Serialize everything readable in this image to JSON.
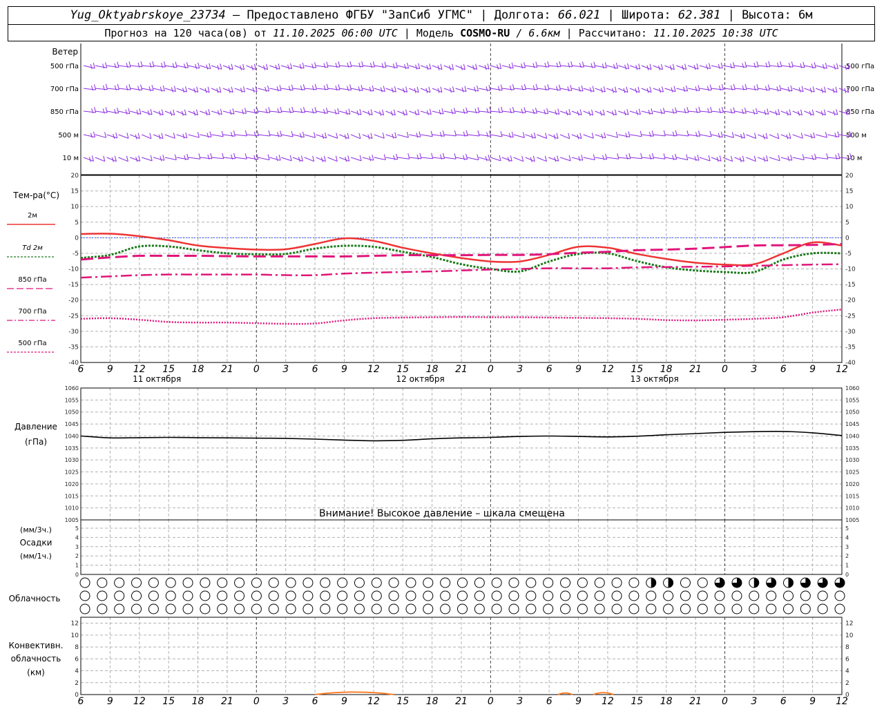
{
  "header": {
    "station": "Yug_Oktyabrskoye_23734",
    "provided_by": "– Предоставлено ФГБУ \"ЗапСиб УГМС\"",
    "lon_label": "Долгота:",
    "lon_value": "66.021",
    "lat_label": "Широта:",
    "lat_value": "62.381",
    "alt_label": "Высота:",
    "alt_value": "6м",
    "forecast_prefix": "Прогноз на 120 часа(ов) от",
    "forecast_start": "11.10.2025 06:00 UTC",
    "model_label": "Модель",
    "model_name": "COSMO-RU",
    "model_res": "/ 6.6км",
    "computed_label": "Рассчитано:",
    "computed_time": "11.10.2025 10:38 UTC"
  },
  "time_axis": {
    "hours": [
      "6",
      "9",
      "12",
      "15",
      "18",
      "21",
      "0",
      "3",
      "6",
      "9",
      "12",
      "15",
      "18",
      "21",
      "0",
      "3",
      "6",
      "9",
      "12",
      "15",
      "18",
      "21",
      "0",
      "3",
      "6",
      "9",
      "12"
    ],
    "day_labels": [
      {
        "text": "11 октября",
        "at_index": 3
      },
      {
        "text": "12 октября",
        "at_index": 12
      },
      {
        "text": "13 октября",
        "at_index": 20
      }
    ],
    "midnight_indices": [
      6,
      14,
      22
    ]
  },
  "wind": {
    "title": "Ветер",
    "levels": [
      "500 гПа",
      "700 гПа",
      "850 гПа",
      "500 м",
      "10 м"
    ],
    "color": "#8a2be2"
  },
  "temperature": {
    "title": "Тем-ра(°С)",
    "ticks": [
      20,
      15,
      10,
      5,
      0,
      -5,
      -10,
      -15,
      -20,
      -25,
      -30,
      -35,
      -40
    ],
    "legend": [
      {
        "label": "2м",
        "color": "#ee3333",
        "style": "solid"
      },
      {
        "label": "Td  2м",
        "color": "#1a7a1a",
        "style": "dotted"
      },
      {
        "label": "850 гПа",
        "color": "#e0147a",
        "style": "dash"
      },
      {
        "label": "700 гПа",
        "color": "#e0147a",
        "style": "dashdot"
      },
      {
        "label": "500 гПа",
        "color": "#e0147a",
        "style": "dot"
      }
    ]
  },
  "pressure": {
    "title_line1": "Давление",
    "title_line2": "(гПа)",
    "ticks": [
      1060,
      1055,
      1050,
      1045,
      1040,
      1035,
      1030,
      1025,
      1020,
      1015,
      1010,
      1005
    ],
    "warning": "Внимание! Высокое давление – шкала смещена"
  },
  "precip": {
    "title_line1": "(мм/3ч.)",
    "title_line2": "Осадки",
    "title_line3": "(мм/1ч.)",
    "ticks": [
      5,
      4,
      3,
      2,
      1,
      0
    ]
  },
  "clouds": {
    "title": "Облачность",
    "rows": 3,
    "count": 41,
    "top_row_fill": [
      0,
      0,
      0,
      0,
      0,
      0,
      0,
      0,
      0,
      0,
      0,
      0,
      0,
      0,
      0,
      0,
      0,
      0,
      0,
      0,
      0,
      0,
      0,
      0,
      0,
      0,
      0,
      0,
      0,
      0,
      0,
      0,
      0,
      0.5,
      0.5,
      0,
      0,
      0.75,
      0.75,
      0.5,
      0.75,
      0.5,
      0.75,
      0.75,
      0.75
    ]
  },
  "convective": {
    "title_line1": "Конвективн.",
    "title_line2": "облачность",
    "title_line3": "(км)",
    "ticks": [
      12,
      10,
      8,
      6,
      4,
      2,
      0
    ],
    "color": "#ff7f27"
  },
  "chart_data": [
    {
      "type": "line",
      "title": "Тем-ра(°С)",
      "x": [
        "6",
        "9",
        "12",
        "15",
        "18",
        "21",
        "0",
        "3",
        "6",
        "9",
        "12",
        "15",
        "18",
        "21",
        "0",
        "3",
        "6",
        "9",
        "12",
        "15",
        "18",
        "21",
        "0",
        "3",
        "6",
        "9",
        "12"
      ],
      "ylim": [
        -40,
        20
      ],
      "series": [
        {
          "name": "2м",
          "values": [
            1.2,
            1.3,
            0.5,
            -0.8,
            -2.5,
            -3.3,
            -3.8,
            -3.7,
            -2.0,
            -0.2,
            -1.0,
            -3.2,
            -5.0,
            -6.5,
            -7.6,
            -7.6,
            -5.5,
            -2.9,
            -3.2,
            -5.2,
            -6.8,
            -8.0,
            -8.6,
            -8.5,
            -5.0,
            -1.5,
            -2.5
          ]
        },
        {
          "name": "Td  2м",
          "values": [
            -6.5,
            -5.5,
            -2.8,
            -2.8,
            -4.0,
            -5.0,
            -5.3,
            -5.2,
            -3.5,
            -2.6,
            -2.9,
            -4.5,
            -6.2,
            -8.5,
            -10.0,
            -10.8,
            -7.6,
            -5.2,
            -5.0,
            -7.5,
            -9.5,
            -10.5,
            -11.0,
            -11.0,
            -7.0,
            -5.0,
            -5.0
          ]
        },
        {
          "name": "850 гПа",
          "values": [
            -7.0,
            -6.3,
            -5.8,
            -5.8,
            -5.8,
            -5.9,
            -6.0,
            -6.0,
            -6.0,
            -6.0,
            -5.8,
            -5.6,
            -5.6,
            -5.6,
            -5.5,
            -5.5,
            -5.3,
            -4.8,
            -4.5,
            -4.0,
            -3.8,
            -3.5,
            -3.0,
            -2.5,
            -2.4,
            -2.3,
            -2.0
          ]
        },
        {
          "name": "700 гПа",
          "values": [
            -12.8,
            -12.4,
            -12.0,
            -11.8,
            -11.8,
            -11.8,
            -11.8,
            -12.0,
            -12.0,
            -11.5,
            -11.2,
            -11.0,
            -10.8,
            -10.5,
            -10.2,
            -10.0,
            -9.8,
            -9.8,
            -9.8,
            -9.5,
            -9.4,
            -9.3,
            -9.2,
            -9.0,
            -8.8,
            -8.6,
            -8.5
          ]
        },
        {
          "name": "500 гПа",
          "values": [
            -26.0,
            -25.8,
            -26.3,
            -27.0,
            -27.2,
            -27.2,
            -27.4,
            -27.6,
            -27.5,
            -26.5,
            -25.8,
            -25.6,
            -25.5,
            -25.4,
            -25.5,
            -25.5,
            -25.6,
            -25.7,
            -25.8,
            -26.0,
            -26.4,
            -26.5,
            -26.3,
            -26.0,
            -25.5,
            -24.0,
            -23.0
          ]
        }
      ]
    },
    {
      "type": "line",
      "title": "Давление (гПа)",
      "x": [
        "6",
        "9",
        "12",
        "15",
        "18",
        "21",
        "0",
        "3",
        "6",
        "9",
        "12",
        "15",
        "18",
        "21",
        "0",
        "3",
        "6",
        "9",
        "12",
        "15",
        "18",
        "21",
        "0",
        "3",
        "6",
        "9",
        "12"
      ],
      "ylim": [
        1005,
        1060
      ],
      "series": [
        {
          "values": [
            1040.0,
            1039.2,
            1039.3,
            1039.4,
            1039.3,
            1039.2,
            1039.1,
            1039.0,
            1038.7,
            1038.3,
            1038.0,
            1038.2,
            1038.8,
            1039.2,
            1039.4,
            1039.8,
            1040.0,
            1039.8,
            1039.6,
            1039.9,
            1040.5,
            1041.0,
            1041.5,
            1041.8,
            1041.9,
            1041.3,
            1040.2
          ]
        }
      ]
    },
    {
      "type": "area",
      "title": "Конвективн. облачность (км)",
      "ylim": [
        0,
        13
      ],
      "segments": [
        {
          "from_index": 8,
          "to_index": 10.7,
          "base": 0,
          "top": 0.6
        },
        {
          "from_index": 16.3,
          "to_index": 16.8,
          "base": 0,
          "top": 0.3
        },
        {
          "from_index": 17.5,
          "to_index": 18.2,
          "base": 0,
          "top": 0.4
        }
      ]
    }
  ]
}
